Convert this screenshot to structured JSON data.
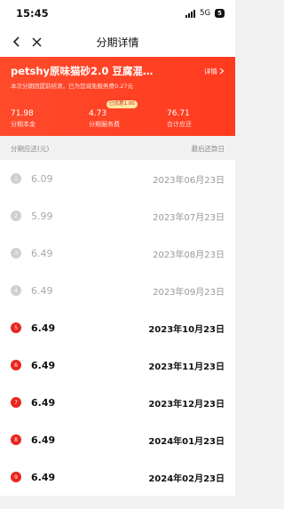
{
  "status_bar": {
    "time": "15:45",
    "network": "5G",
    "battery": "5"
  },
  "nav": {
    "title": "分期详情"
  },
  "header": {
    "title": "petshy原味猫砂2.0 豆腐混…",
    "detail_label": "详情",
    "notice": "本次分期因提前结清，已为您减免服务费0.27元",
    "stats": [
      {
        "value": "71.98",
        "label": "分期本金"
      },
      {
        "value": "4.73",
        "label": "分期服务费",
        "badge": "已优惠1.00"
      },
      {
        "value": "76.71",
        "label": "合计应还"
      }
    ]
  },
  "list_header": {
    "left": "分期应还(元)",
    "right": "最后还款日"
  },
  "installments": [
    {
      "no": "1",
      "amount": "6.09",
      "date": "2023年06月23日",
      "status": "paid"
    },
    {
      "no": "2",
      "amount": "5.99",
      "date": "2023年07月23日",
      "status": "paid"
    },
    {
      "no": "3",
      "amount": "6.49",
      "date": "2023年08月23日",
      "status": "paid"
    },
    {
      "no": "4",
      "amount": "6.49",
      "date": "2023年09月23日",
      "status": "paid"
    },
    {
      "no": "5",
      "amount": "6.49",
      "date": "2023年10月23日",
      "status": "unpaid"
    },
    {
      "no": "6",
      "amount": "6.49",
      "date": "2023年11月23日",
      "status": "unpaid"
    },
    {
      "no": "7",
      "amount": "6.49",
      "date": "2023年12月23日",
      "status": "unpaid"
    },
    {
      "no": "8",
      "amount": "6.49",
      "date": "2024年01月23日",
      "status": "unpaid"
    },
    {
      "no": "9",
      "amount": "6.49",
      "date": "2024年02月23日",
      "status": "unpaid"
    }
  ],
  "colors": {
    "accent": "#ff3d22",
    "unpaid_marker": "#e9261f",
    "paid_marker": "#cfcfcf"
  }
}
